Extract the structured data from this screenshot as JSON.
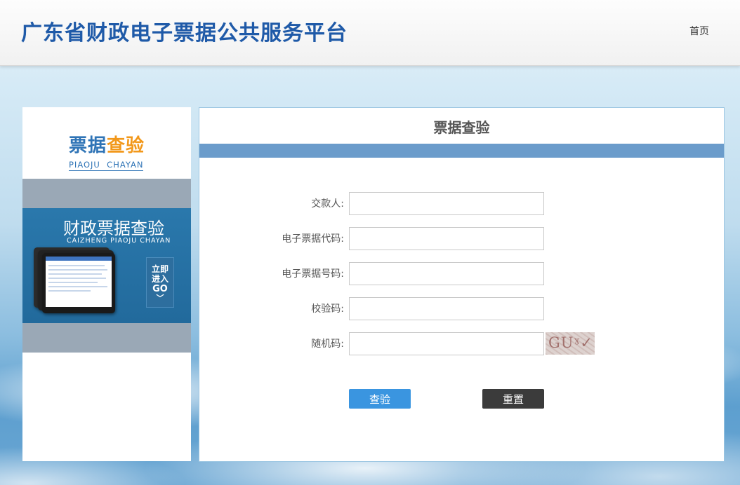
{
  "header": {
    "site_title": "广东省财政电子票据公共服务平台",
    "nav_home": "首页"
  },
  "sidebar": {
    "title_part1": "票据",
    "title_part2": "查验",
    "subtitle": "PIAOJU  CHAYAN",
    "banner": {
      "title": "财政票据查验",
      "subtitle": "CAIZHENG PIAOJU CHAYAN",
      "go_line1": "立即",
      "go_line2": "进入",
      "go_line3": "GO",
      "go_chevron": "﹀"
    }
  },
  "form": {
    "title": "票据查验",
    "fields": [
      {
        "label": "交款人:",
        "value": ""
      },
      {
        "label": "电子票据代码:",
        "value": ""
      },
      {
        "label": "电子票据号码:",
        "value": ""
      },
      {
        "label": "校验码:",
        "value": ""
      },
      {
        "label": "随机码:",
        "value": ""
      }
    ],
    "captcha_text": "GUˠ✓",
    "verify_label": "查验",
    "reset_label": "重置"
  },
  "colors": {
    "title_blue": "#1f5aa8",
    "accent_orange": "#f2981b",
    "panel_bar": "#6b9ccb",
    "verify_button": "#3a95e0",
    "reset_button": "#3b3b3b"
  }
}
